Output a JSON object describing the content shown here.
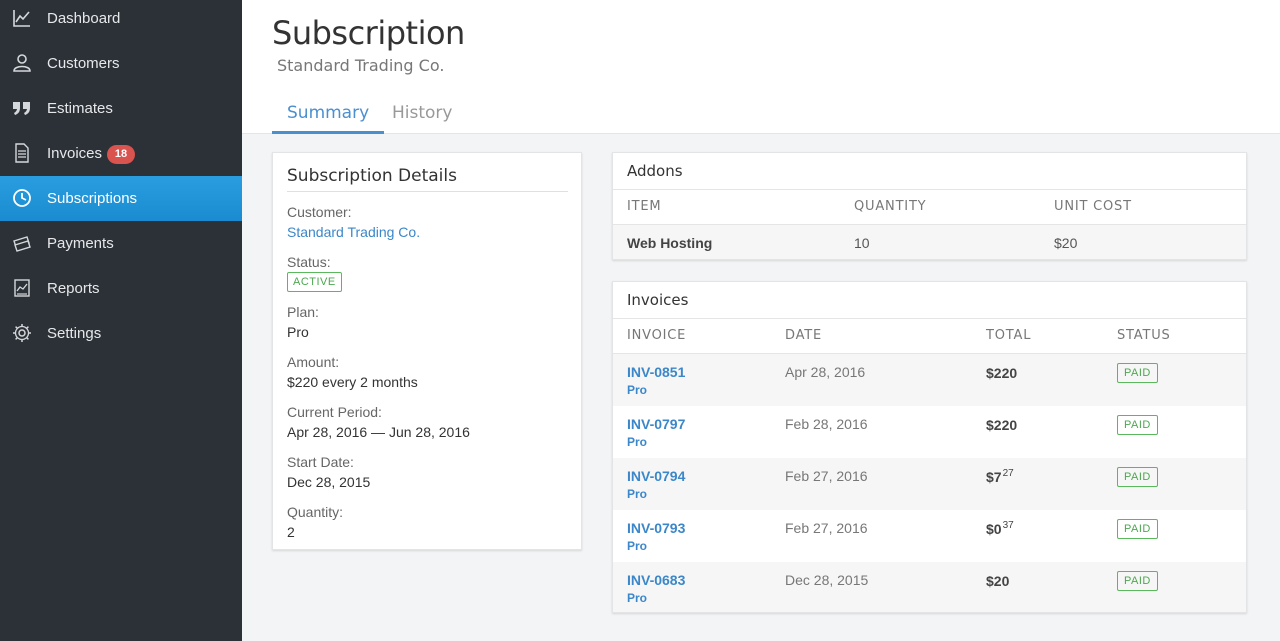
{
  "sidebar": {
    "items": [
      {
        "label": "Dashboard",
        "icon": "chart-line-icon"
      },
      {
        "label": "Customers",
        "icon": "user-icon"
      },
      {
        "label": "Estimates",
        "icon": "quote-icon"
      },
      {
        "label": "Invoices",
        "icon": "document-icon",
        "badge": "18"
      },
      {
        "label": "Subscriptions",
        "icon": "clock-icon",
        "active": true
      },
      {
        "label": "Payments",
        "icon": "cash-icon"
      },
      {
        "label": "Reports",
        "icon": "report-icon"
      },
      {
        "label": "Settings",
        "icon": "gear-icon"
      }
    ]
  },
  "header": {
    "title": "Subscription",
    "subtitle": "Standard Trading Co.",
    "tabs": [
      "Summary",
      "History"
    ]
  },
  "details": {
    "title": "Subscription Details",
    "customer_label": "Customer:",
    "customer_value": "Standard Trading Co.",
    "status_label": "Status:",
    "status_value": "ACTIVE",
    "plan_label": "Plan:",
    "plan_value": "Pro",
    "amount_label": "Amount:",
    "amount_value": "$220 every 2 months",
    "period_label": "Current Period:",
    "period_value": "Apr 28, 2016 — Jun 28, 2016",
    "start_label": "Start Date:",
    "start_value": "Dec 28, 2015",
    "quantity_label": "Quantity:",
    "quantity_value": "2"
  },
  "addons": {
    "title": "Addons",
    "columns": [
      "ITEM",
      "QUANTITY",
      "UNIT COST"
    ],
    "rows": [
      {
        "item": "Web Hosting",
        "quantity": "10",
        "unit_cost": "$20"
      }
    ]
  },
  "invoices": {
    "title": "Invoices",
    "columns": [
      "INVOICE",
      "DATE",
      "TOTAL",
      "STATUS"
    ],
    "rows": [
      {
        "number": "INV-0851",
        "plan": "Pro",
        "date": "Apr 28, 2016",
        "total_main": "$220",
        "total_cents": "",
        "status": "PAID"
      },
      {
        "number": "INV-0797",
        "plan": "Pro",
        "date": "Feb 28, 2016",
        "total_main": "$220",
        "total_cents": "",
        "status": "PAID"
      },
      {
        "number": "INV-0794",
        "plan": "Pro",
        "date": "Feb 27, 2016",
        "total_main": "$7",
        "total_cents": "27",
        "status": "PAID"
      },
      {
        "number": "INV-0793",
        "plan": "Pro",
        "date": "Feb 27, 2016",
        "total_main": "$0",
        "total_cents": "37",
        "status": "PAID"
      },
      {
        "number": "INV-0683",
        "plan": "Pro",
        "date": "Dec 28, 2015",
        "total_main": "$20",
        "total_cents": "",
        "status": "PAID"
      }
    ]
  },
  "colors": {
    "sidebar_bg": "#2c3138",
    "active_blue": "#1e93d6",
    "link_blue": "#3b87c9",
    "paid_green": "#5cb85c",
    "badge_red": "#d9534f"
  }
}
